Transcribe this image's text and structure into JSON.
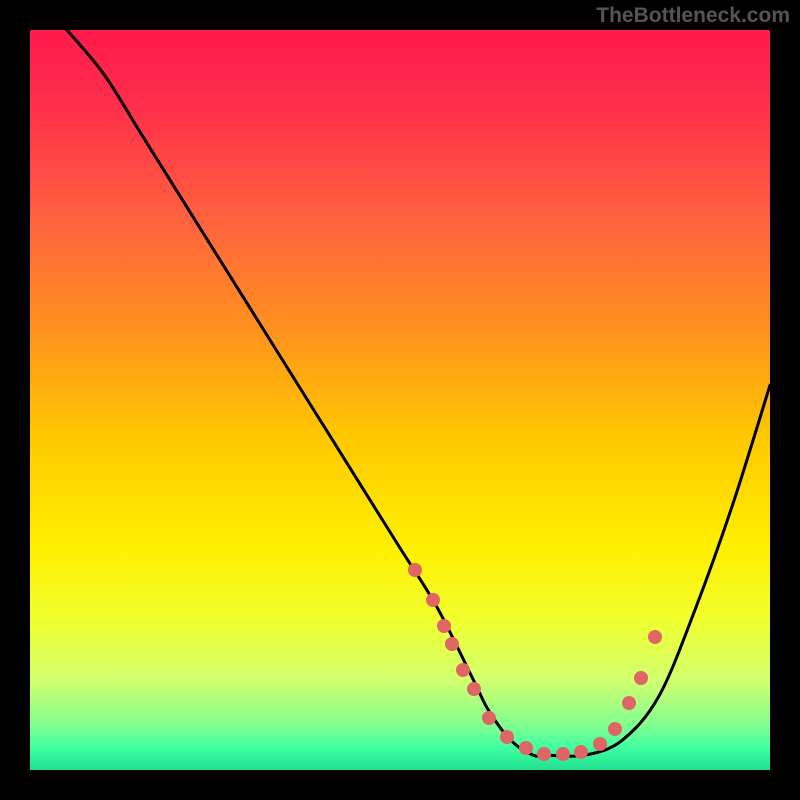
{
  "watermark": "TheBottleneck.com",
  "chart_data": {
    "type": "line",
    "title": "",
    "xlabel": "",
    "ylabel": "",
    "xlim": [
      0,
      100
    ],
    "ylim": [
      0,
      100
    ],
    "gradient": {
      "stops": [
        {
          "pos": 0.0,
          "color": "#ff1a4d"
        },
        {
          "pos": 0.1,
          "color": "#ff2e4a"
        },
        {
          "pos": 0.25,
          "color": "#ff6040"
        },
        {
          "pos": 0.4,
          "color": "#ff9020"
        },
        {
          "pos": 0.55,
          "color": "#ffc800"
        },
        {
          "pos": 0.7,
          "color": "#fff000"
        },
        {
          "pos": 0.8,
          "color": "#f0ff30"
        },
        {
          "pos": 0.88,
          "color": "#d0ff70"
        },
        {
          "pos": 0.94,
          "color": "#80ff90"
        },
        {
          "pos": 0.97,
          "color": "#40ffa0"
        },
        {
          "pos": 1.0,
          "color": "#20e090"
        }
      ]
    },
    "series": [
      {
        "name": "bottleneck-curve",
        "x": [
          5,
          10,
          15,
          20,
          25,
          30,
          35,
          40,
          45,
          50,
          55,
          60,
          62,
          65,
          68,
          70,
          75,
          80,
          85,
          90,
          95,
          100
        ],
        "y": [
          100,
          94,
          86,
          78,
          70,
          62,
          54,
          46,
          38,
          30,
          22,
          12,
          8,
          4,
          2,
          2,
          2,
          4,
          10,
          22,
          36,
          52
        ]
      }
    ],
    "scatter_points": {
      "name": "highlight-dots",
      "color": "#e06666",
      "x": [
        52,
        54.5,
        56,
        57,
        58.5,
        60,
        62,
        64.5,
        67,
        69.5,
        72,
        74.5,
        77,
        79,
        81,
        82.5,
        84.5
      ],
      "y": [
        27,
        23,
        19.5,
        17,
        13.5,
        11,
        7,
        4.5,
        3,
        2.2,
        2.2,
        2.5,
        3.5,
        5.5,
        9,
        12.5,
        18
      ]
    }
  }
}
